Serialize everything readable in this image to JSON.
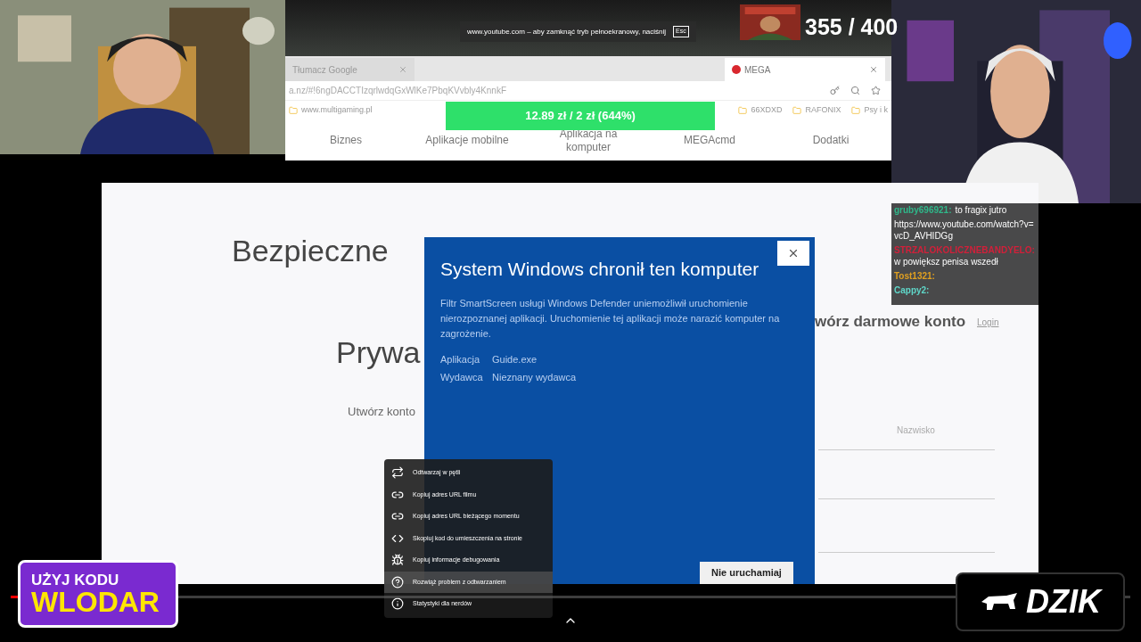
{
  "fullscreen_notice": {
    "text": "www.youtube.com – aby zamknąć tryb pełnoekranowy, naciśnij",
    "key": "Esc"
  },
  "goal": {
    "count": "355 / 400",
    "donation": "12.89 zł / 2 zł (644%)"
  },
  "browser": {
    "tabs": [
      {
        "label": "Tłumacz Google",
        "selected": false
      },
      {
        "label": "MEGA",
        "selected": true
      }
    ],
    "address": "a.nz/#!6ngDACCTIzqrlwdqGxWlKe7PbqKVvbly4KnnkF",
    "bookmarks": [
      "www.multigaming.pl",
      "66XDXD",
      "RAFONIX",
      "Psy i k"
    ],
    "nav": [
      "Biznes",
      "Aplikacje mobilne",
      "Aplikacja na komputer",
      "MEGAcmd",
      "Dodatki"
    ]
  },
  "page": {
    "headline": "Bezpieczne",
    "subheadline": "Prywa",
    "cta": "Utwórz konto",
    "signup_title": "wórz darmowe konto",
    "login": "Login",
    "surname_placeholder": "Nazwisko"
  },
  "dialog": {
    "title": "System Windows chronił ten komputer",
    "body": "Filtr SmartScreen usługi Windows Defender uniemożliwił uruchomienie nierozpoznanej aplikacji. Uruchomienie tej aplikacji może narazić komputer na zagrożenie.",
    "details": [
      {
        "label": "Aplikacja",
        "value": "Guide.exe"
      },
      {
        "label": "Wydawca",
        "value": "Nieznany wydawca"
      }
    ],
    "button": "Nie uruchamiaj"
  },
  "chat": [
    {
      "user": "gruby696921:",
      "color": "#2fb88a",
      "text": "to fragix jutro"
    },
    {
      "text": "https://www.youtube.com/watch?v=vcD_AVHIDGg"
    },
    {
      "user": "STRZALOKOLICZNEBANDYELO:",
      "color": "#d0203a",
      "text": "w powiększ penisa wszedł"
    },
    {
      "user": "Tost1321:",
      "color": "#e0a020"
    },
    {
      "user": "Cappy2:",
      "color": "#5fd6c8"
    }
  ],
  "context_menu": [
    {
      "kind": "loop",
      "label": "Odtwarzaj w pętli",
      "selected": false
    },
    {
      "kind": "link",
      "label": "Kopiuj adres URL filmu",
      "selected": false
    },
    {
      "kind": "link",
      "label": "Kopiuj adres URL bieżącego momentu",
      "selected": false
    },
    {
      "kind": "code",
      "label": "Skopiuj kod do umieszczenia na stronie",
      "selected": false
    },
    {
      "kind": "bug",
      "label": "Kopiuj informacje debugowania",
      "selected": false
    },
    {
      "kind": "help",
      "label": "Rozwiąż problem z odtwarzaniem",
      "selected": true
    },
    {
      "kind": "info",
      "label": "Statystyki dla nerdów",
      "selected": false
    }
  ],
  "promo": {
    "line1": "UŻYJ KODU",
    "line2": "WLODAR"
  },
  "sponsor": "DZIK",
  "player": {
    "level": 0.01
  }
}
